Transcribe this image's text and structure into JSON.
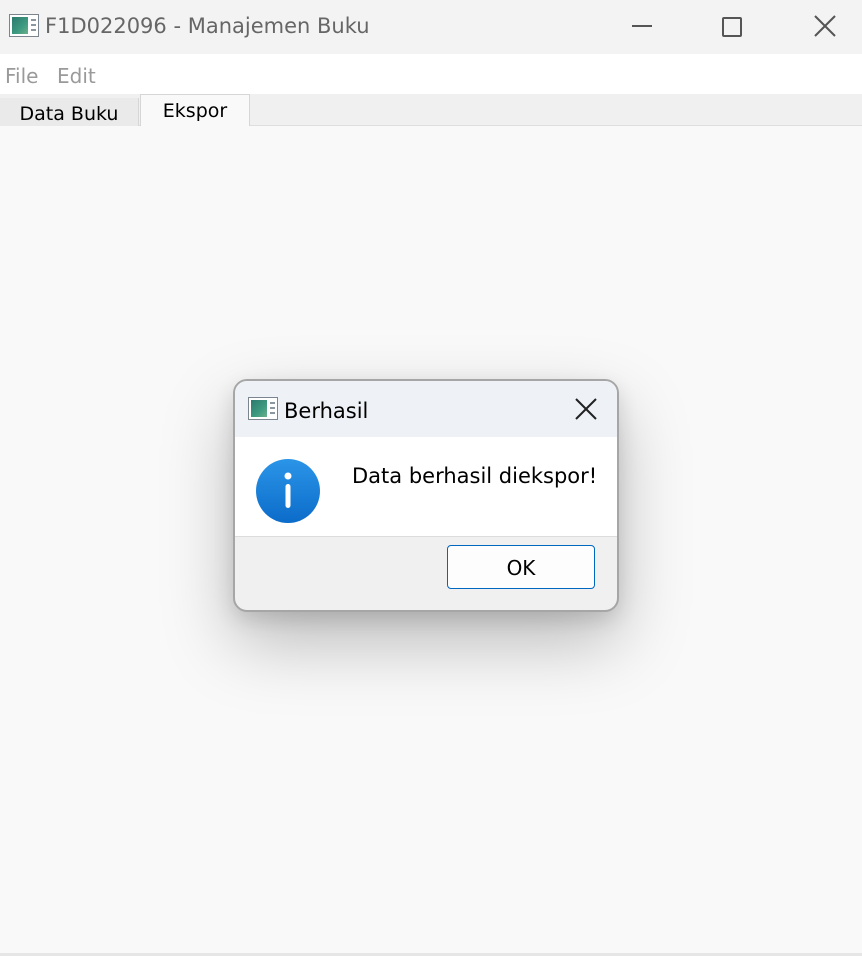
{
  "window": {
    "title": "F1D022096 - Manajemen Buku",
    "controls": [
      "minimize-icon",
      "maximize-icon",
      "close-icon"
    ]
  },
  "menu": {
    "items": [
      {
        "label": "File"
      },
      {
        "label": "Edit"
      }
    ]
  },
  "tabs": [
    {
      "label": "Data Buku",
      "selected": false
    },
    {
      "label": "Ekspor",
      "selected": true
    }
  ],
  "dialog": {
    "title": "Berhasil",
    "message": "Data berhasil diekspor!",
    "icon": "info-icon",
    "ok_label": "OK"
  },
  "colors": {
    "accent": "#0067c0",
    "info": "#1a7fd8"
  }
}
